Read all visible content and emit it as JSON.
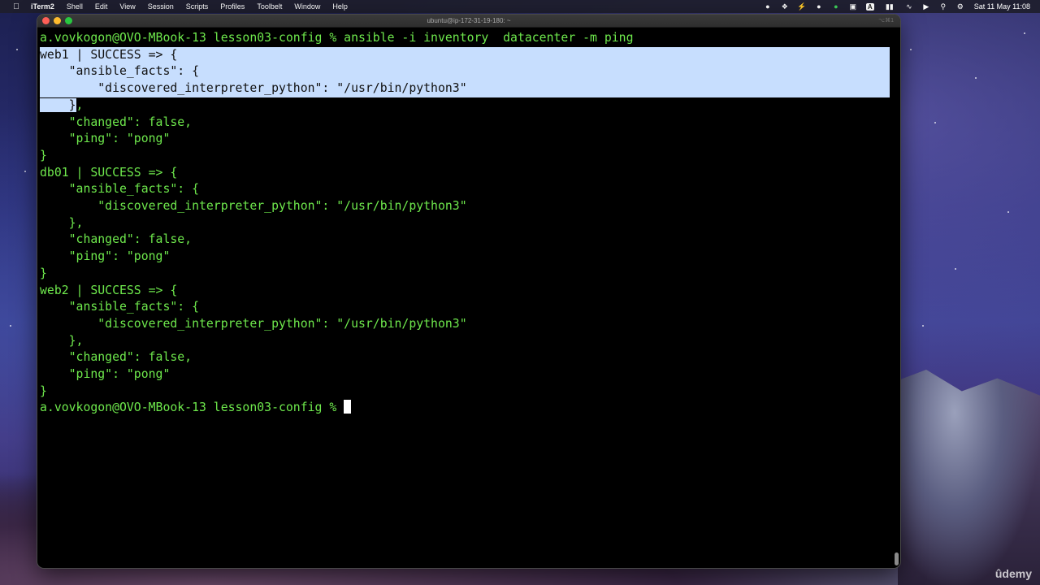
{
  "menubar": {
    "app_name": "iTerm2",
    "items": [
      "Shell",
      "Edit",
      "View",
      "Session",
      "Scripts",
      "Profiles",
      "Toolbelt",
      "Window",
      "Help"
    ],
    "clock": "Sat 11 May  11:08",
    "status_icons": [
      "record-icon",
      "dropbox-icon",
      "bolt-icon",
      "dot-icon",
      "dot-green-icon",
      "box-icon",
      "keyboard-a-icon",
      "battery-icon",
      "wifi-icon",
      "play-icon",
      "search-icon",
      "control-center-icon"
    ]
  },
  "window": {
    "title": "ubuntu@ip-172-31-19-180: ~",
    "shortcut": "⌥⌘1"
  },
  "terminal": {
    "lines": [
      "a.vovkogon@OVO-MBook-13 lesson03-config % ansible -i inventory  datacenter -m ping",
      "web1 | SUCCESS => {",
      "    \"ansible_facts\": {",
      "        \"discovered_interpreter_python\": \"/usr/bin/python3\"",
      "    },",
      "    \"changed\": false,",
      "    \"ping\": \"pong\"",
      "}",
      "db01 | SUCCESS => {",
      "    \"ansible_facts\": {",
      "        \"discovered_interpreter_python\": \"/usr/bin/python3\"",
      "    },",
      "    \"changed\": false,",
      "    \"ping\": \"pong\"",
      "}",
      "web2 | SUCCESS => {",
      "    \"ansible_facts\": {",
      "        \"discovered_interpreter_python\": \"/usr/bin/python3\"",
      "    },",
      "    \"changed\": false,",
      "    \"ping\": \"pong\"",
      "}",
      "a.vovkogon@OVO-MBook-13 lesson03-config % "
    ],
    "selected_lines": [
      1,
      2,
      3
    ],
    "partial_selection": {
      "line": 4,
      "chars": 5
    },
    "text_color": "#6ee84c",
    "selection_color": "#c7defe"
  },
  "watermark": "ûdemy"
}
